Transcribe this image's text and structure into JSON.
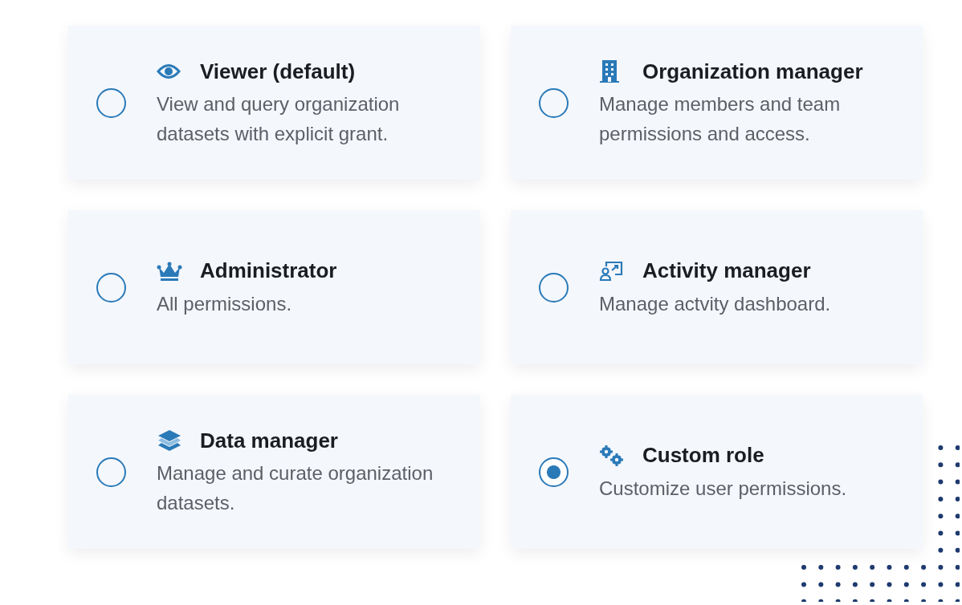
{
  "roles": [
    {
      "title": "Viewer (default)",
      "description": "View and query organization datasets with explicit grant.",
      "selected": false
    },
    {
      "title": "Organization manager",
      "description": "Manage members and team permissions and access.",
      "selected": false
    },
    {
      "title": "Administrator",
      "description": "All permissions.",
      "selected": false
    },
    {
      "title": "Activity manager",
      "description": "Manage actvity dashboard.",
      "selected": false
    },
    {
      "title": "Data manager",
      "description": "Manage and curate organization datasets.",
      "selected": false
    },
    {
      "title": "Custom role",
      "description": "Customize user permissions.",
      "selected": true
    }
  ]
}
